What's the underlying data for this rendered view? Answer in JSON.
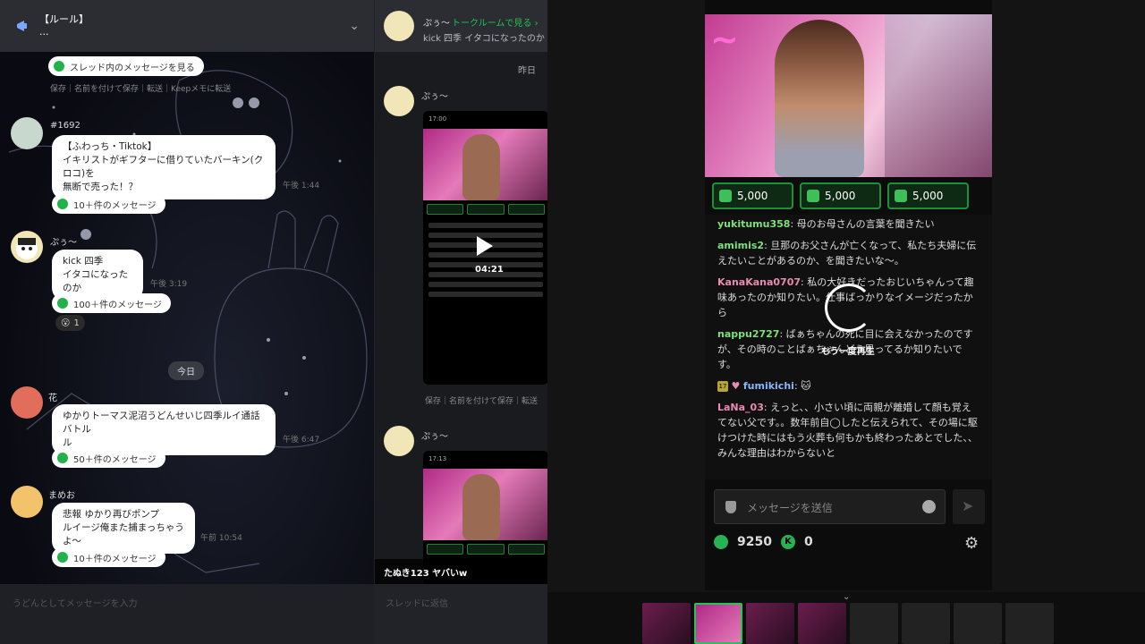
{
  "left_panel": {
    "announcement": {
      "title": "【ルール】",
      "subtitle": "..."
    },
    "thread_pill_1": "スレッド内のメッセージを見る",
    "actions": "保存｜名前を付けて保存｜転送｜Keepメモに転送",
    "messages": [
      {
        "name": "#1692",
        "text": "【ふわっち・Tiktok】\nイキリストがギフターに借りていたバーキン(クロコ)を\n無断で売った！？",
        "time": "午後 1:44",
        "thread": "10＋件のメッセージ"
      },
      {
        "name": "ぷぅ〜",
        "text": "kick 四季\nイタコになったのか",
        "time": "午後 3:19",
        "thread": "100＋件のメッセージ",
        "reaction_count": "1"
      },
      {
        "name": "花",
        "text": "ゆかりトーマス泥沼うどんせいじ四季ルイ通話バトル\nル",
        "time": "午後 6:47",
        "thread": "50＋件のメッセージ"
      },
      {
        "name": "まめお",
        "text": "悲報 ゆかり再びポンプ\nルイージ俺また捕まっちゃうよ〜",
        "time": "午前 10:54",
        "thread": "10＋件のメッセージ"
      }
    ],
    "date_chip": "今日",
    "input_placeholder": "うどんとしてメッセージを入力"
  },
  "mid_panel": {
    "header_name": "ぷぅ〜",
    "header_link": "トークルームで見る ›",
    "header_sub": "kick 四季 イタコになったのか",
    "date": "昨日",
    "post_name_1": "ぷぅ〜",
    "post_name_2": "ぷぅ〜",
    "shot_time_1": "17:00",
    "shot_time_2": "17:13",
    "duration": "04:21",
    "actions": "保存｜名前を付けて保存｜転送",
    "overlay": "たぬき123 ヤバいw",
    "input_placeholder": "スレッドに返信"
  },
  "stream": {
    "gifts": [
      "5,000",
      "5,000",
      "5,000"
    ],
    "comments": [
      {
        "user": "yukitumu358",
        "color": "green",
        "text": "母のお母さんの言葉を聞きたい"
      },
      {
        "user": "amimis2",
        "color": "green",
        "text": "旦那のお父さんが亡くなって、私たち夫婦に伝えたいことがあるのか、を聞きたいな〜。"
      },
      {
        "user": "KanaKana0707",
        "color": "pink",
        "text": "私の大好きだったおじいちゃんって趣味あったのか知りたい。仕事ばっかりなイメージだったから"
      },
      {
        "user": "nappu2727",
        "color": "green",
        "text": "ばぁちゃんの死に目に会えなかったのですが、その時のことばぁちゃんどう思ってるか知りたいです。"
      },
      {
        "user": "fumikichi",
        "color": "blue",
        "text": "",
        "level": "17"
      },
      {
        "user": "LaNa_03",
        "color": "pink",
        "text": "えっと、、小さい頃に両親が離婚して顔も覚えてない父です。。数年前自◯したと伝えられて、その場に駆けつけた時にはもう火葬も何もかも終わったあとでした、、みんな理由はわからないと"
      }
    ],
    "replay_label": "もう一度再生",
    "send_placeholder": "メッセージを送信",
    "coins": "9250",
    "kicks": "0",
    "send_icon": "➤",
    "gear_icon": "⚙"
  }
}
